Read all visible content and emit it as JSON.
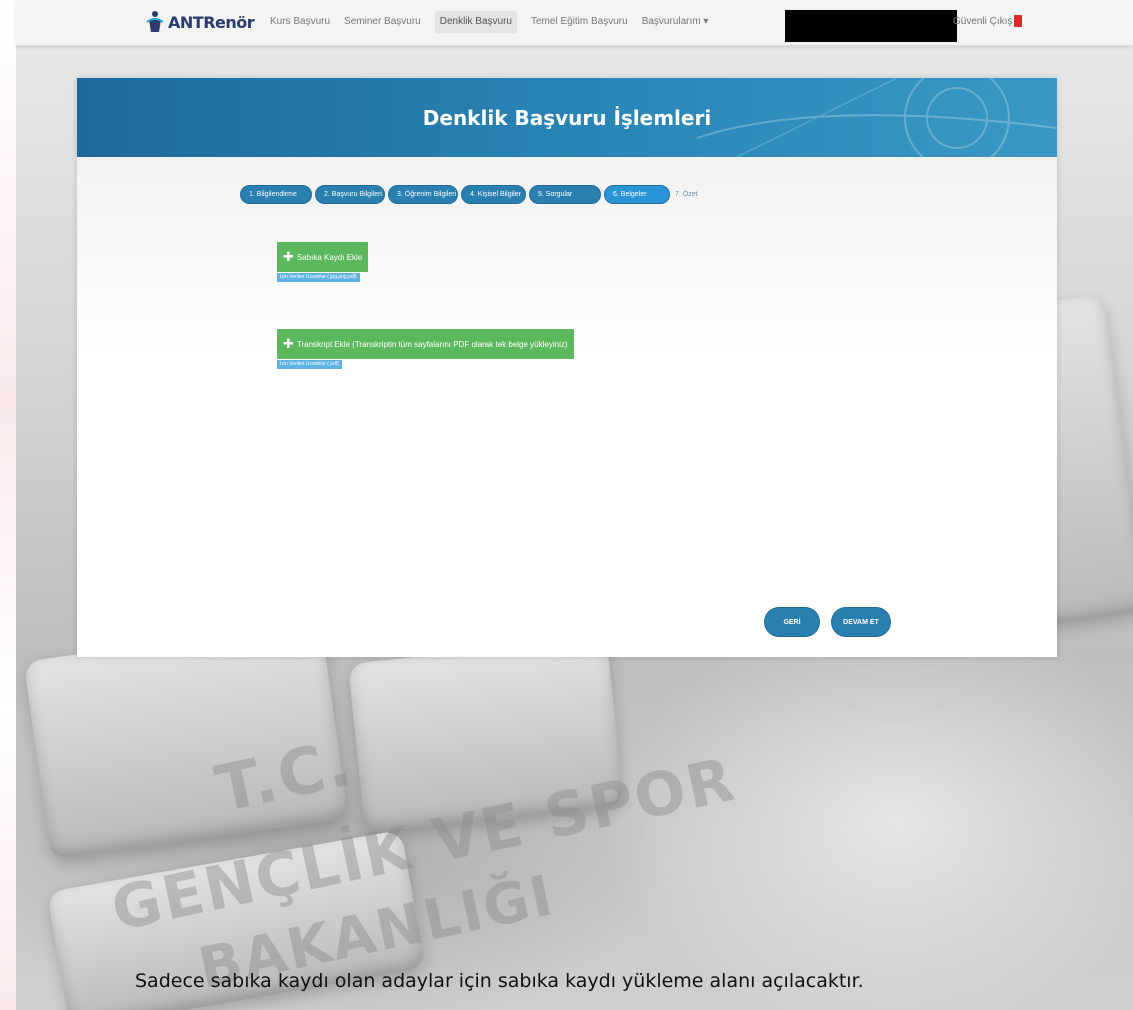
{
  "nav": {
    "brand_prefix": "ANT",
    "brand_suffix": "Renör",
    "items": [
      "Kurs Başvuru",
      "Seminer Başvuru",
      "Denklik Başvuru",
      "Temel Eğitim Başvuru",
      "Başvurularım ▾"
    ],
    "active_index": 2,
    "logout_label": "Güvenli Çıkış"
  },
  "card": {
    "title": "Denklik Başvuru İşlemleri",
    "steps": [
      "1. Bilgilendirme",
      "2. Başvuru Bilgileri",
      "3. Öğrenim Bilgileri",
      "4. Kişisel Bilgiler",
      "5. Sorgular",
      "6. Belgeler",
      "7. Özet"
    ],
    "current_step": 6,
    "uploads": [
      {
        "label": "Sabıka Kaydı Ekle",
        "note": "İzin Verilen Uzantılar ( jpg,png,pdf)"
      },
      {
        "label": "Transkript Ekle (Transkriptin tüm sayfalarını PDF olarak tek belge yükleyiniz)",
        "note": "İzin Verilen Uzantılar ( pdf)"
      }
    ],
    "back_label": "GERİ",
    "next_label": "DEVAM ET"
  },
  "caption": "Sadece sabıka kaydı olan adaylar için sabıka kaydı yükleme alanı açılacaktır.",
  "colors": {
    "header_blue": "#1d6a9a",
    "step_blue": "#2a7fb1",
    "upload_green": "#5cb85c",
    "note_blue": "#5fb3e3"
  }
}
